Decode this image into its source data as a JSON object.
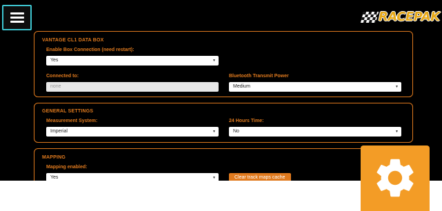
{
  "header": {
    "menu_icon": "hamburger-menu-icon",
    "logo_text": "RACEPAK",
    "logo_color": "#e6a817"
  },
  "sections": {
    "databox": {
      "title": "VANTAGE CL1 DATA BOX",
      "enable_label": "Enable Box Connection (need restart):",
      "enable_value": "Yes",
      "connected_label": "Connected to:",
      "connected_value": "none",
      "bt_label": "Bluetooth Transmit Power",
      "bt_value": "Medium"
    },
    "general": {
      "title": "GENERAL SETTINGS",
      "measurement_label": "Measurement System:",
      "measurement_value": "Imperial",
      "time_label": "24 Hours Time:",
      "time_value": "No"
    },
    "mapping": {
      "title": "MAPPING",
      "enabled_label": "Mapping enabled:",
      "enabled_value": "Yes",
      "clear_button": "Clear track maps cache"
    }
  },
  "settings_tile": {
    "icon": "gear-icon",
    "color": "#f39c26"
  },
  "colors": {
    "accent": "#e07a1e",
    "menu_border": "#3ec6d1",
    "background": "#000000"
  }
}
